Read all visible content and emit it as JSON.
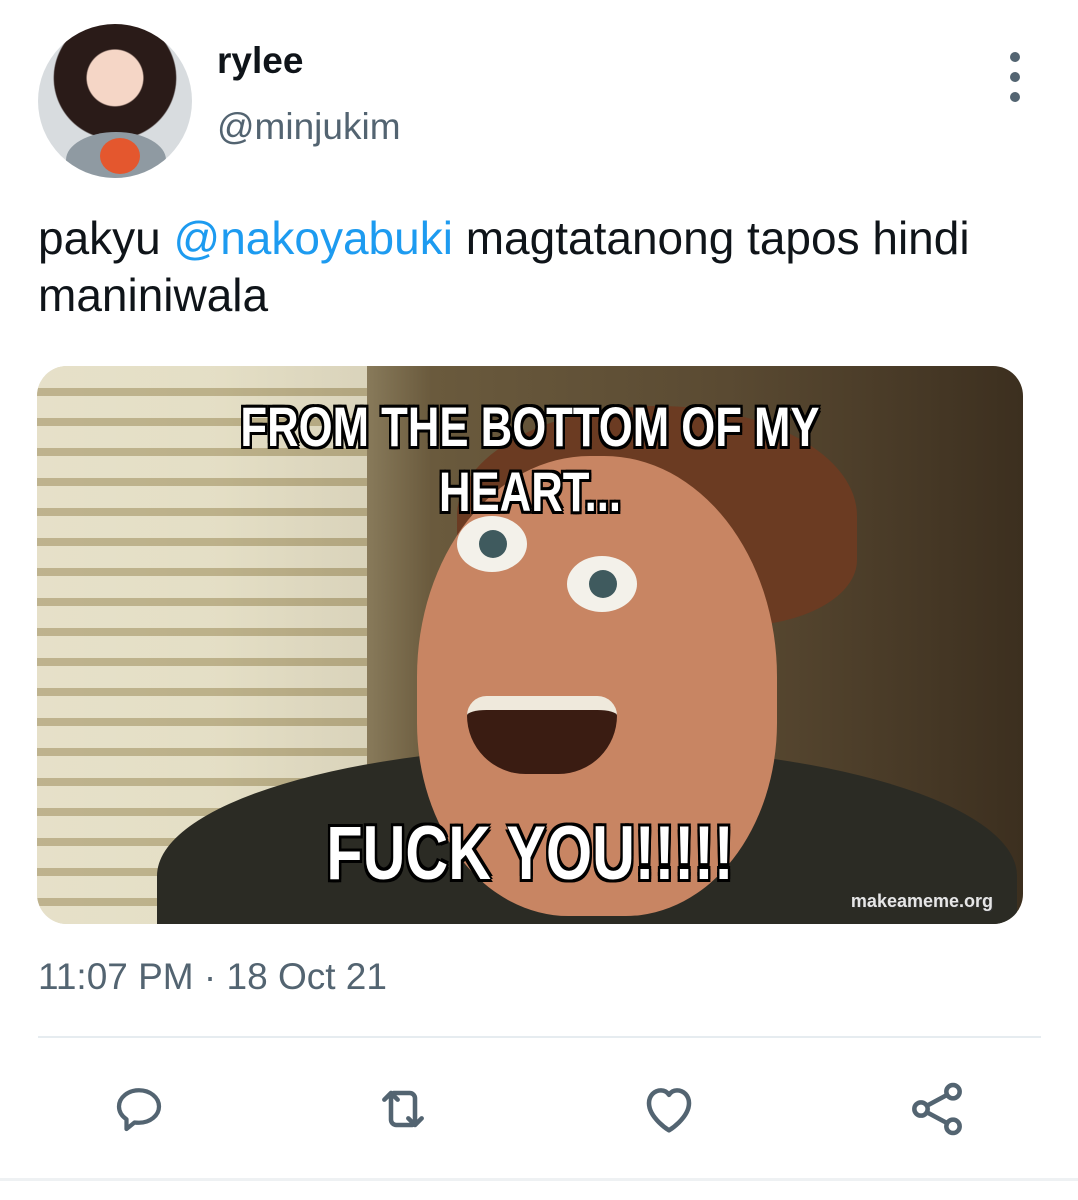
{
  "tweet": {
    "display_name": "rylee",
    "handle": "@minjukim",
    "text_before": "pakyu ",
    "mention": "@nakoyabuki",
    "text_after": " magtatanong tapos hindi maniniwala",
    "timestamp": "11:07 PM · 18 Oct 21"
  },
  "media": {
    "top_caption": "FROM THE BOTTOM OF MY HEART...",
    "bottom_caption": "FUCK YOU!!!!!",
    "watermark": "makeameme.org"
  },
  "icons": {
    "more": "more-vertical-icon",
    "reply": "reply-icon",
    "retweet": "retweet-icon",
    "like": "heart-icon",
    "share": "share-icon"
  },
  "colors": {
    "text": "#0f1419",
    "secondary": "#536471",
    "mention": "#1d9bf0",
    "divider": "#e6ecf0"
  }
}
